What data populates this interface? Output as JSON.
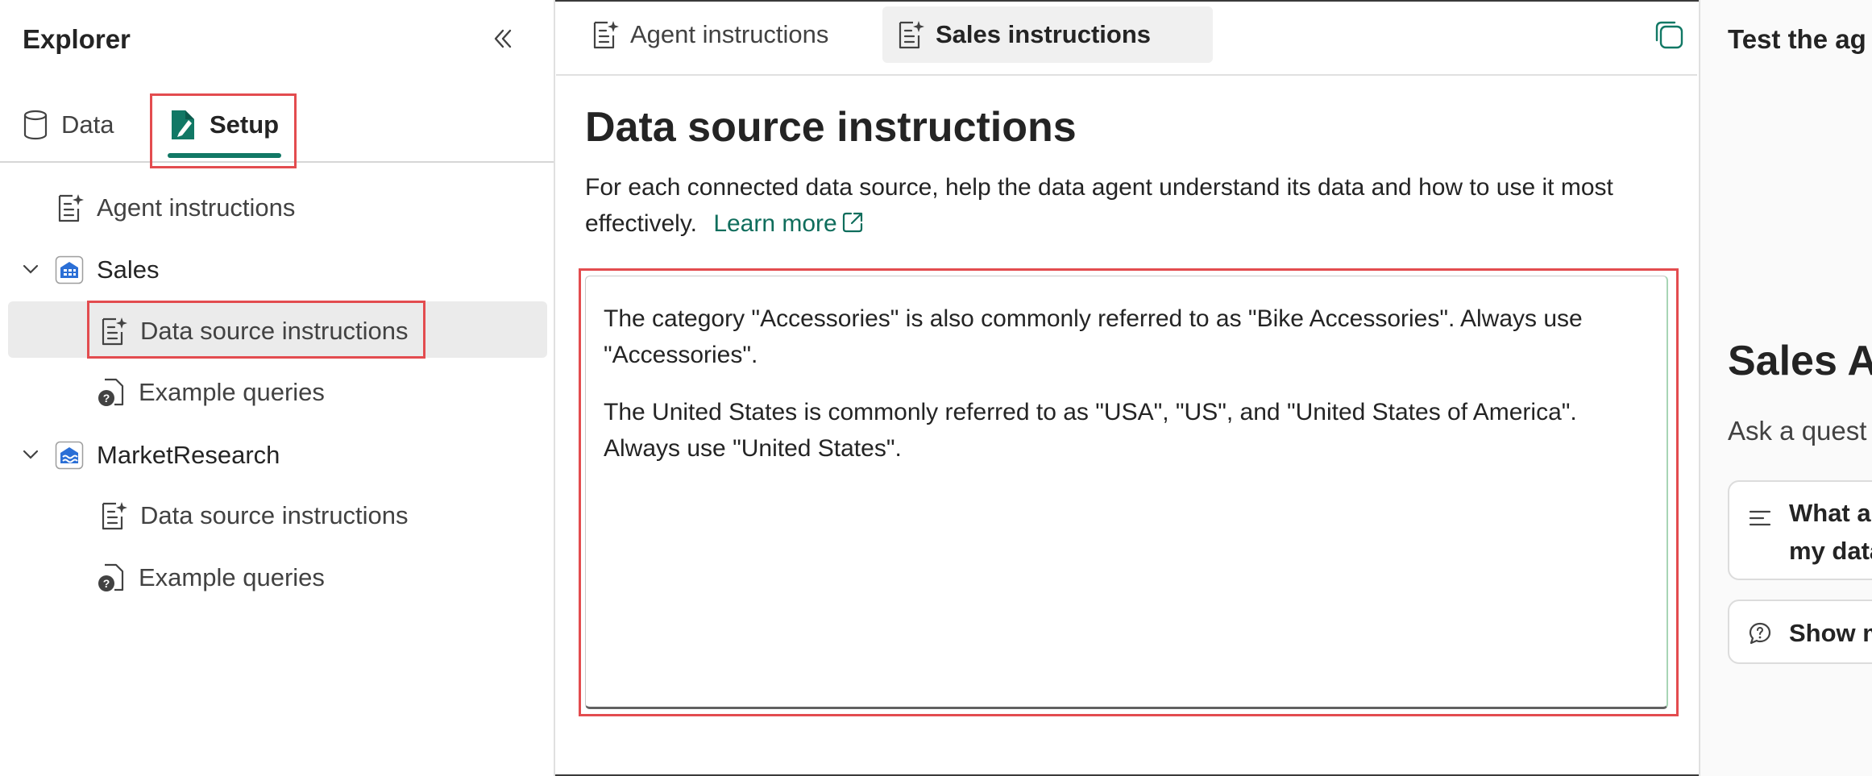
{
  "explorer": {
    "title": "Explorer",
    "tabs": [
      {
        "label": "Data"
      },
      {
        "label": "Setup"
      }
    ],
    "tree": [
      {
        "label": "Agent instructions"
      },
      {
        "label": "Sales"
      },
      {
        "label": "Data source instructions"
      },
      {
        "label": "Example queries"
      },
      {
        "label": "MarketResearch"
      },
      {
        "label": "Data source instructions"
      },
      {
        "label": "Example queries"
      }
    ]
  },
  "doc_tabs": [
    {
      "label": "Agent instructions"
    },
    {
      "label": "Sales instructions"
    }
  ],
  "main": {
    "heading": "Data source instructions",
    "description": "For each connected data source, help the data agent understand its data and how to use it most effectively.",
    "learn_more": "Learn more",
    "paragraphs": [
      "The category \"Accessories\" is also commonly referred to as \"Bike Accessories\". Always use \"Accessories\".",
      "The United States is commonly referred to as \"USA\", \"US\", and \"United States of America\". Always use \"United States\"."
    ]
  },
  "test_pane": {
    "title": "Test the ag",
    "agent_name": "Sales A",
    "ask": "Ask a quest",
    "suggestion1_line1": "What a",
    "suggestion1_line2": "my data",
    "suggestion2": "Show m"
  },
  "colors": {
    "accent": "#117865",
    "link": "#0f6d5c",
    "highlight": "#e34c4f",
    "selected_bg": "#ebebeb"
  }
}
